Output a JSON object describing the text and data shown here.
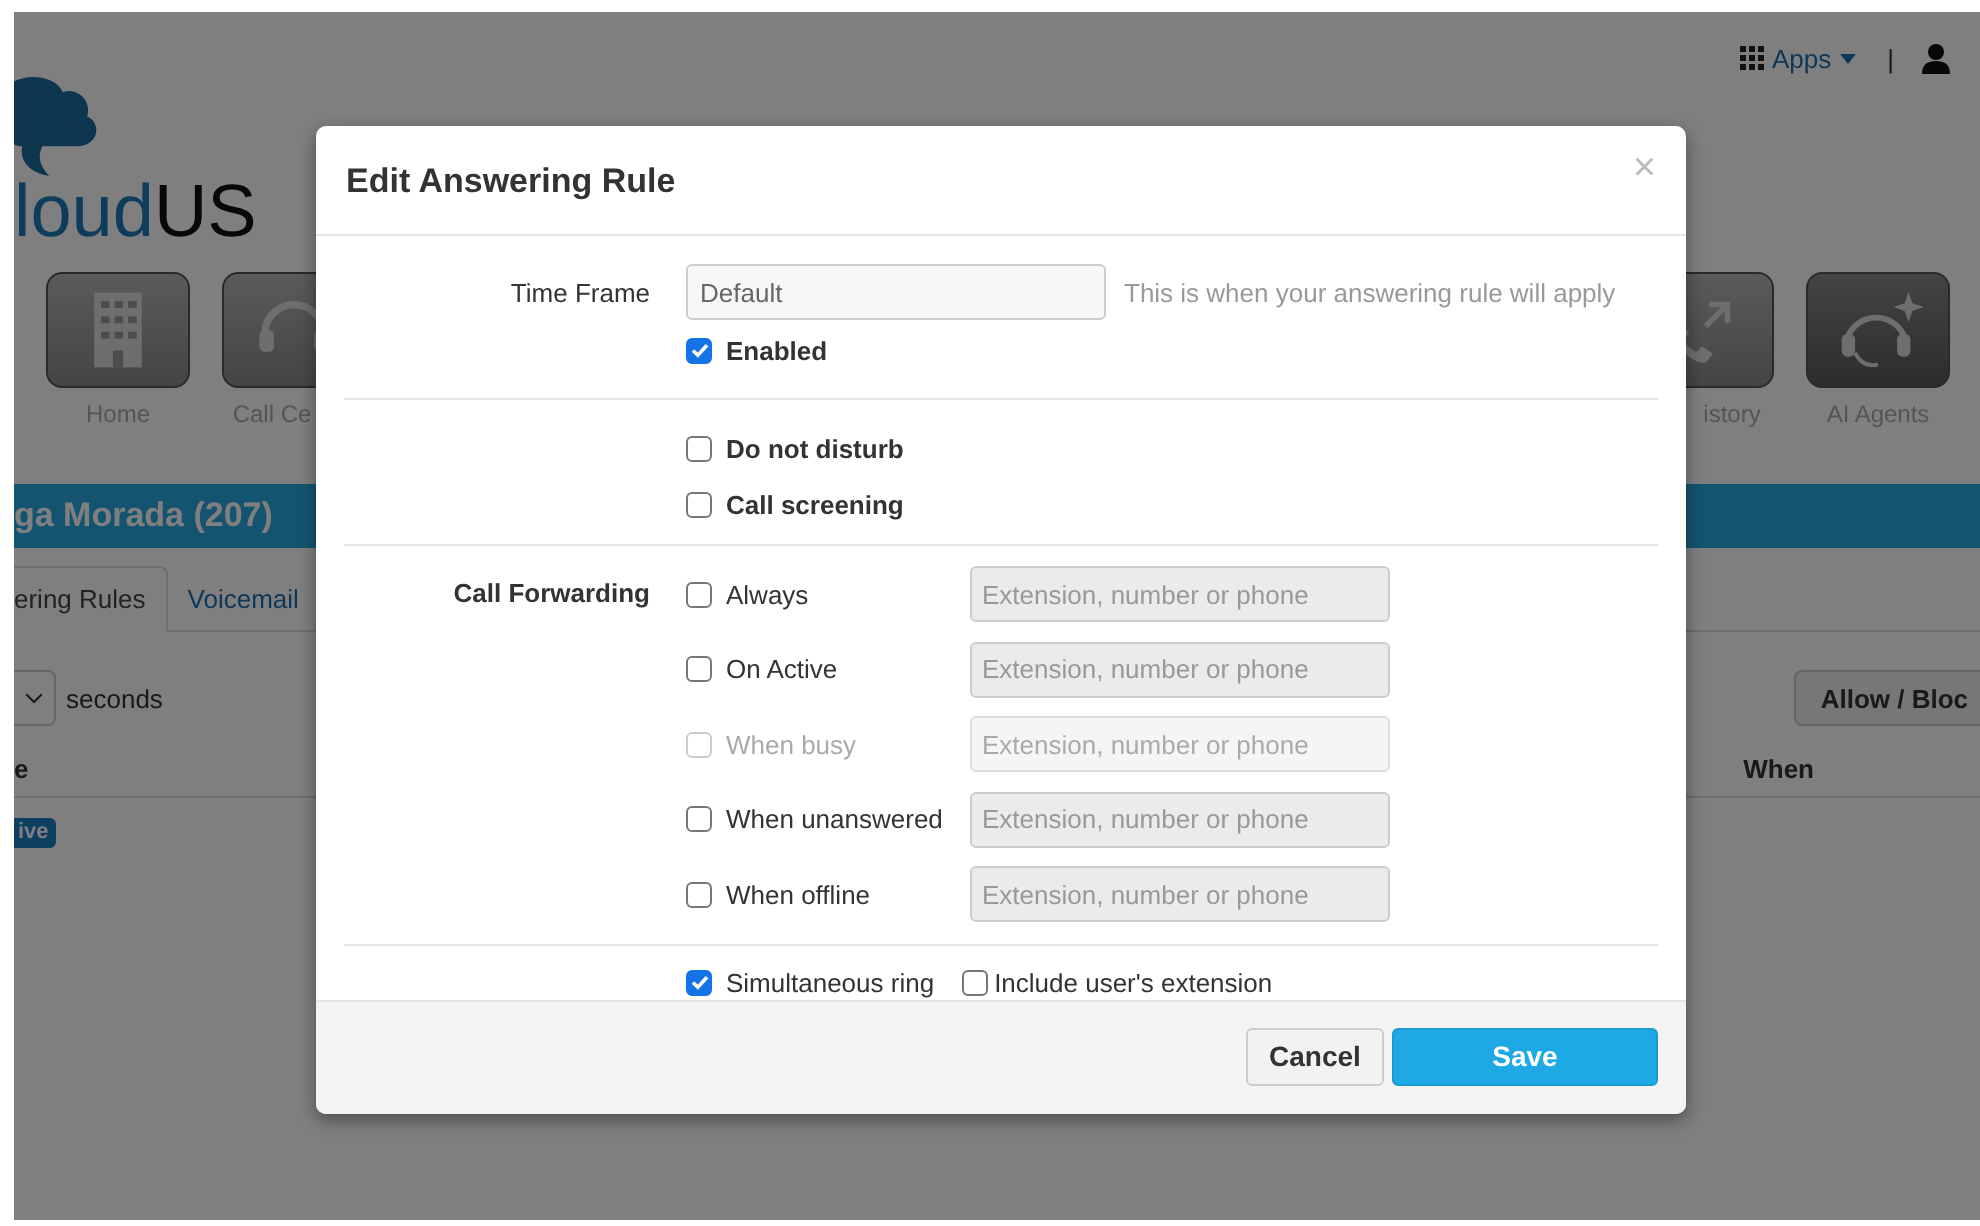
{
  "top_bar": {
    "apps_label": "Apps",
    "separator": "|"
  },
  "logo": {
    "prefix": "loud",
    "suffix": "US"
  },
  "app_icons_left": [
    {
      "label": "Home",
      "kind": "building"
    },
    {
      "label": "Call Ce",
      "kind": "headset"
    }
  ],
  "app_icons_right": [
    {
      "label": "istory",
      "kind": "phone-arrows"
    },
    {
      "label": "AI Agents",
      "kind": "ai-headset"
    }
  ],
  "page_header": {
    "title": "ga Morada (207)"
  },
  "tabs": [
    {
      "label": "ering Rules",
      "selected": true
    },
    {
      "label": "Voicemail",
      "selected": false
    }
  ],
  "toolbar": {
    "unit": "seconds",
    "button": "Allow / Bloc"
  },
  "table": {
    "columns": [
      "e",
      "When"
    ],
    "rows": [
      {
        "status": "ive"
      }
    ]
  },
  "modal": {
    "title": "Edit Answering Rule",
    "close": "×",
    "time_frame": {
      "label": "Time Frame",
      "value": "Default",
      "help": "This is when your answering rule will apply"
    },
    "enabled": {
      "label": "Enabled",
      "checked": true
    },
    "options": [
      {
        "label": "Do not disturb",
        "checked": false
      },
      {
        "label": "Call screening",
        "checked": false
      }
    ],
    "call_forwarding": {
      "label": "Call Forwarding",
      "rules": [
        {
          "label": "Always",
          "checked": false,
          "disabled": false,
          "placeholder": "Extension, number or phone"
        },
        {
          "label": "On Active",
          "checked": false,
          "disabled": false,
          "placeholder": "Extension, number or phone"
        },
        {
          "label": "When busy",
          "checked": false,
          "disabled": true,
          "placeholder": "Extension, number or phone"
        },
        {
          "label": "When unanswered",
          "checked": false,
          "disabled": false,
          "placeholder": "Extension, number or phone"
        },
        {
          "label": "When offline",
          "checked": false,
          "disabled": false,
          "placeholder": "Extension, number or phone"
        }
      ]
    },
    "simultaneous_ring": {
      "label": "Simultaneous ring",
      "checked": true
    },
    "include_extension": {
      "label": "Include user's extension",
      "checked": false
    },
    "buttons": [
      {
        "label": "Cancel",
        "kind": "default"
      },
      {
        "label": "Save",
        "kind": "primary"
      }
    ]
  }
}
